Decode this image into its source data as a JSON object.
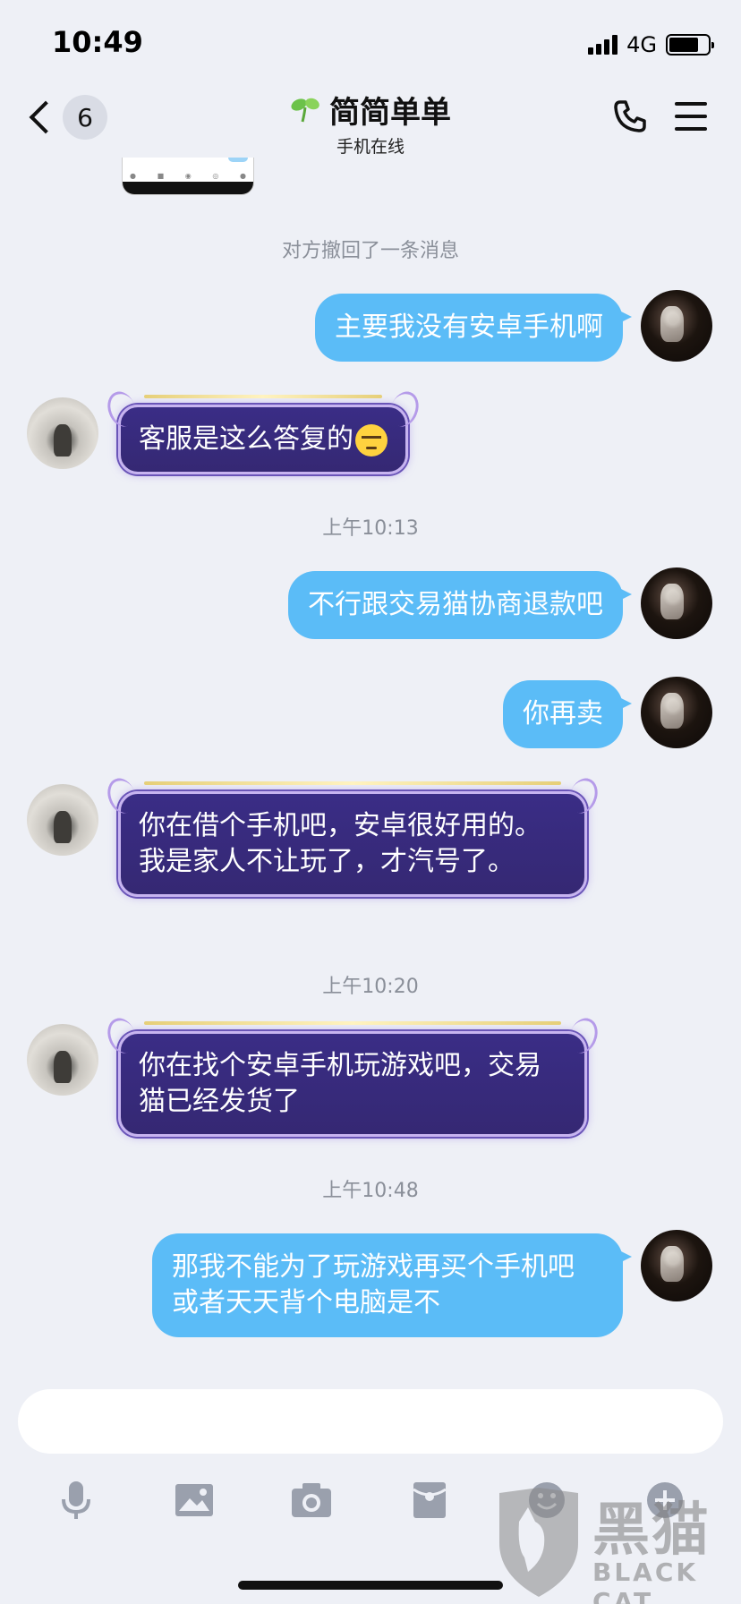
{
  "status_bar": {
    "time": "10:49",
    "network": "4G",
    "battery_level": 0.75
  },
  "nav": {
    "unread_count": "6",
    "title": "简简单单",
    "subtitle": "手机在线",
    "title_icon": "sprout-icon",
    "back_icon": "chevron-left-icon",
    "call_icon": "phone-icon",
    "menu_icon": "menu-icon"
  },
  "chat": {
    "system_recall": "对方撤回了一条消息",
    "messages": [
      {
        "side": "out",
        "text": "主要我没有安卓手机啊"
      },
      {
        "side": "in",
        "text": "客服是这么答复的",
        "emoji": "sweat-smile-emoji"
      },
      {
        "side": "time",
        "text": "上午10:13"
      },
      {
        "side": "out",
        "text": "不行跟交易猫协商退款吧"
      },
      {
        "side": "out",
        "text": "你再卖"
      },
      {
        "side": "in",
        "text": "你在借个手机吧，安卓很好用的。我是家人不让玩了，才汽号了。"
      },
      {
        "side": "time",
        "text": "上午10:20"
      },
      {
        "side": "in",
        "text": "你在找个安卓手机玩游戏吧，交易猫已经发货了"
      },
      {
        "side": "time",
        "text": "上午10:48"
      },
      {
        "side": "out",
        "text": "那我不能为了玩游戏再买个手机吧 或者天天背个电脑是不"
      }
    ]
  },
  "input": {
    "value": "",
    "placeholder": ""
  },
  "toolbar": {
    "icons": [
      "microphone-icon",
      "image-icon",
      "camera-icon",
      "red-packet-icon",
      "emoji-icon",
      "plus-icon"
    ]
  },
  "watermark": {
    "cn": "黑猫",
    "en": "BLACK CAT"
  },
  "colors": {
    "outgoing_bubble": "#5bbcf7",
    "incoming_bubble": "#3a2d86",
    "background": "#eef0f6"
  }
}
